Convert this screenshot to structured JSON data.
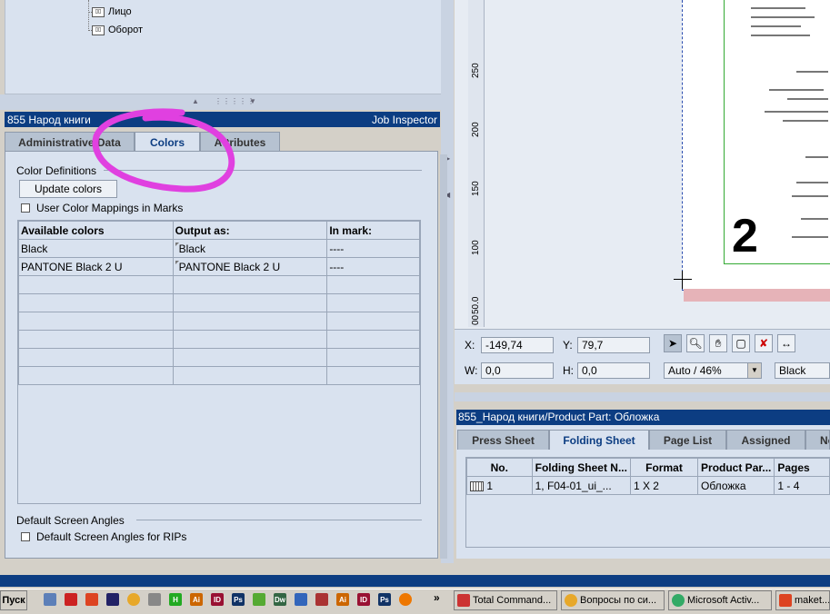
{
  "tree": {
    "items": [
      "Лицо",
      "Оборот"
    ]
  },
  "job_inspector": {
    "title": "855  Народ книги",
    "label": "Job Inspector"
  },
  "tabs": [
    {
      "label": "Administrative Data"
    },
    {
      "label": "Colors"
    },
    {
      "label": "Attributes"
    }
  ],
  "color_definitions": {
    "title": "Color Definitions",
    "update_button": "Update colors",
    "user_mapping_label": "User Color Mappings in Marks",
    "columns": [
      "Available colors",
      "Output as:",
      "In mark:"
    ],
    "rows": [
      [
        "Black",
        "Black",
        "----"
      ],
      [
        "PANTONE Black 2 U",
        "PANTONE Black 2 U",
        "----"
      ]
    ]
  },
  "screen_angles": {
    "title": "Default Screen Angles",
    "checkbox_label": "Default Screen Angles for RIPs"
  },
  "ruler": {
    "ticks": [
      "250",
      "200",
      "150",
      "100",
      "50.0",
      "00"
    ]
  },
  "preview": {
    "page_number": "2"
  },
  "coords": {
    "x_label": "X:",
    "x_value": "-149,74",
    "y_label": "Y:",
    "y_value": "79,7",
    "w_label": "W:",
    "w_value": "0,0",
    "h_label": "H:",
    "h_value": "0,0",
    "zoom": "Auto  / 46%",
    "color": "Black"
  },
  "product_part": {
    "title": "855_Народ книги/Product Part: Обложка",
    "tabs": [
      "Press Sheet",
      "Folding Sheet",
      "Page List",
      "Assigned",
      "Not"
    ],
    "columns": [
      "No.",
      "Folding Sheet N...",
      "Format",
      "Product Par...",
      "Pages"
    ],
    "rows": [
      [
        "1",
        "1, F04-01_ui_...",
        "1 X 2",
        "Обложка",
        "1 - 4"
      ]
    ]
  },
  "taskbar": {
    "start": "Пуск",
    "tasks": [
      "Total Command...",
      "Вопросы по си...",
      "Microsoft Activ...",
      "maket..."
    ]
  },
  "colors": {
    "accent": "#0c3d82",
    "panel": "#d9e2ef",
    "highlight": "#e040e0"
  }
}
